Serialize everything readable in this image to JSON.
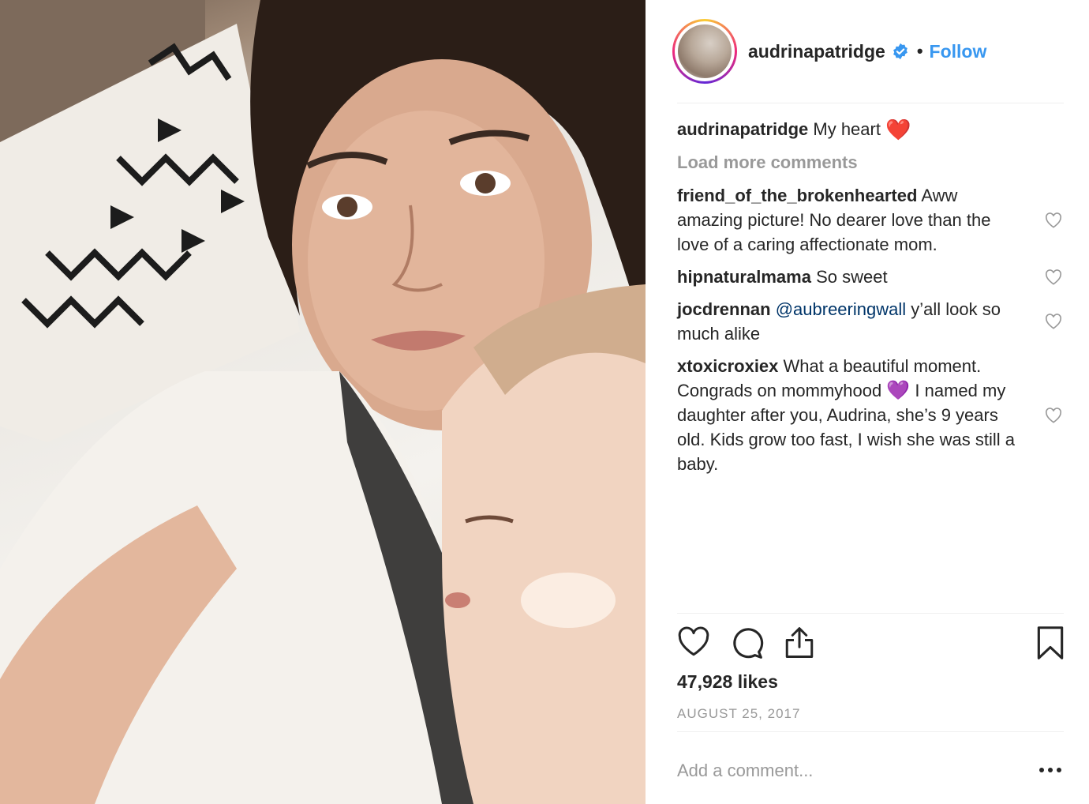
{
  "post": {
    "username": "audrinapatridge",
    "follow_label": "Follow",
    "separator": "•",
    "caption": {
      "username": "audrinapatridge",
      "text": "My heart",
      "emoji": "❤️"
    },
    "load_more_label": "Load more comments",
    "comments": [
      {
        "username": "friend_of_the_brokenhearted",
        "text": "Aww amazing picture! No dearer love than the love of a caring affectionate mom."
      },
      {
        "username": "hipnaturalmama",
        "text": "So sweet"
      },
      {
        "username": "jocdrennan",
        "mention": "@aubreeringwall",
        "text": "y’all look so much alike"
      },
      {
        "username": "xtoxicroxiex",
        "text_before": "What a beautiful moment. Congrads on mommyhood",
        "emoji": "💜",
        "text_after": "I named my daughter after you, Audrina, she’s 9 years old. Kids grow too fast, I wish she was still a baby."
      }
    ],
    "likes": "47,928 likes",
    "date": "AUGUST 25, 2017",
    "add_comment_placeholder": "Add a comment...",
    "more_label": "..."
  },
  "icons": {
    "verified": "verified-badge-icon",
    "like": "heart-outline-icon",
    "comment": "speech-bubble-icon",
    "share": "share-upload-icon",
    "save": "bookmark-icon",
    "comment_like": "small-heart-icon",
    "more": "ellipsis-icon"
  },
  "colors": {
    "link_blue": "#3897f0",
    "mention_blue": "#003569",
    "muted_gray": "#999999",
    "text": "#262626",
    "divider": "#efefef"
  }
}
